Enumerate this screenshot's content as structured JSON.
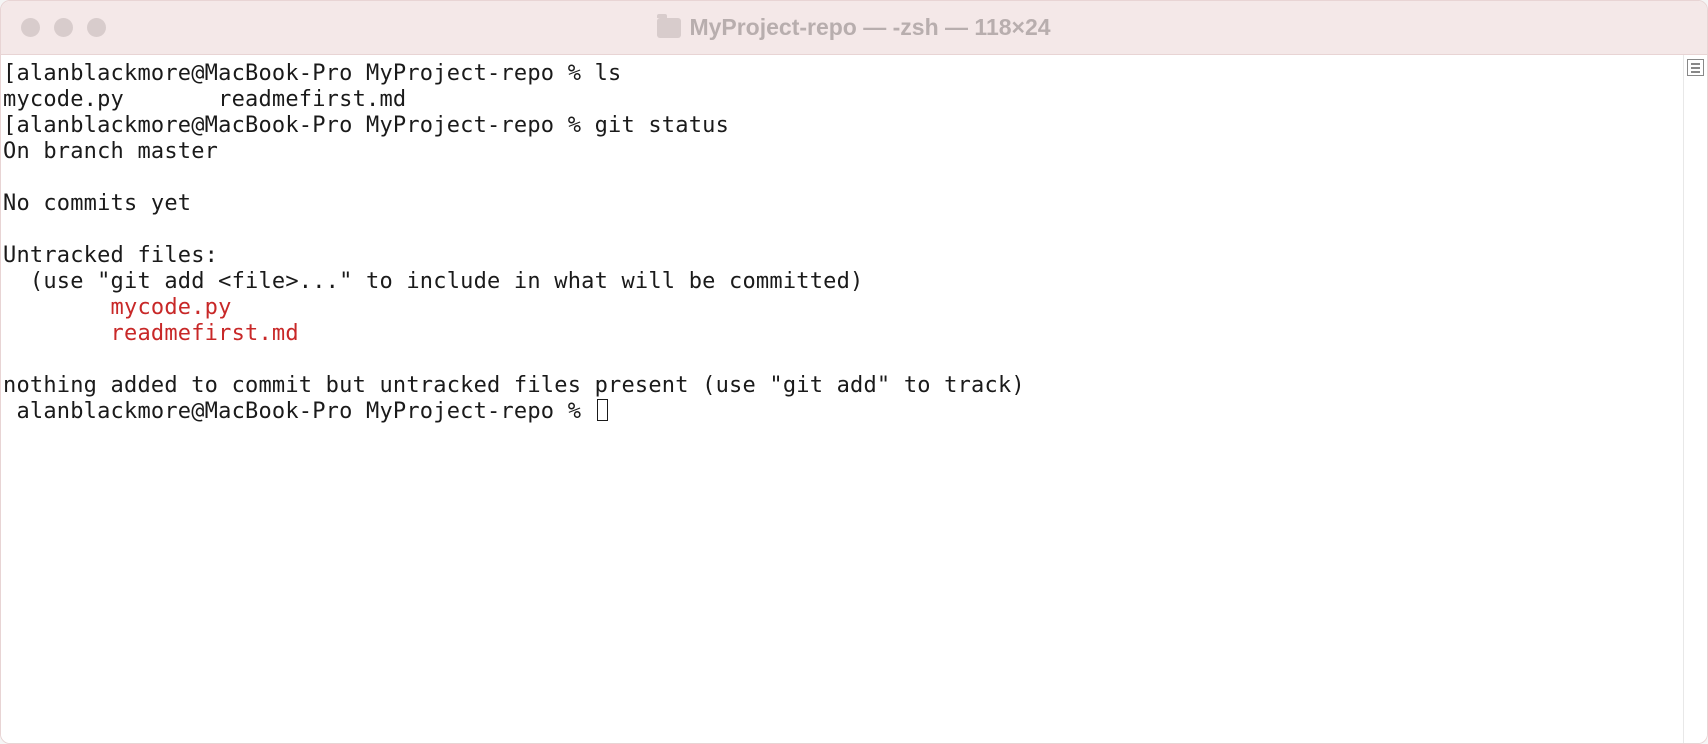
{
  "window": {
    "title": "MyProject-repo — -zsh — 118×24"
  },
  "terminal": {
    "prompt": "alanblackmore@MacBook-Pro MyProject-repo % ",
    "lines": {
      "l0a": "[alanblackmore@MacBook-Pro MyProject-repo % ls",
      "l0b": "                                                                                    ]",
      "l1": "mycode.py       readmefirst.md",
      "l2a": "[alanblackmore@MacBook-Pro MyProject-repo % git status",
      "l2b": "                                                                            ]",
      "l3": "On branch master",
      "l4": "",
      "l5": "No commits yet",
      "l6": "",
      "l7": "Untracked files:",
      "l8": "  (use \"git add <file>...\" to include in what will be committed)",
      "l9": "        mycode.py",
      "l10": "        readmefirst.md",
      "l11": "",
      "l12": "nothing added to commit but untracked files present (use \"git add\" to track)",
      "l13": " alanblackmore@MacBook-Pro MyProject-repo % "
    }
  }
}
